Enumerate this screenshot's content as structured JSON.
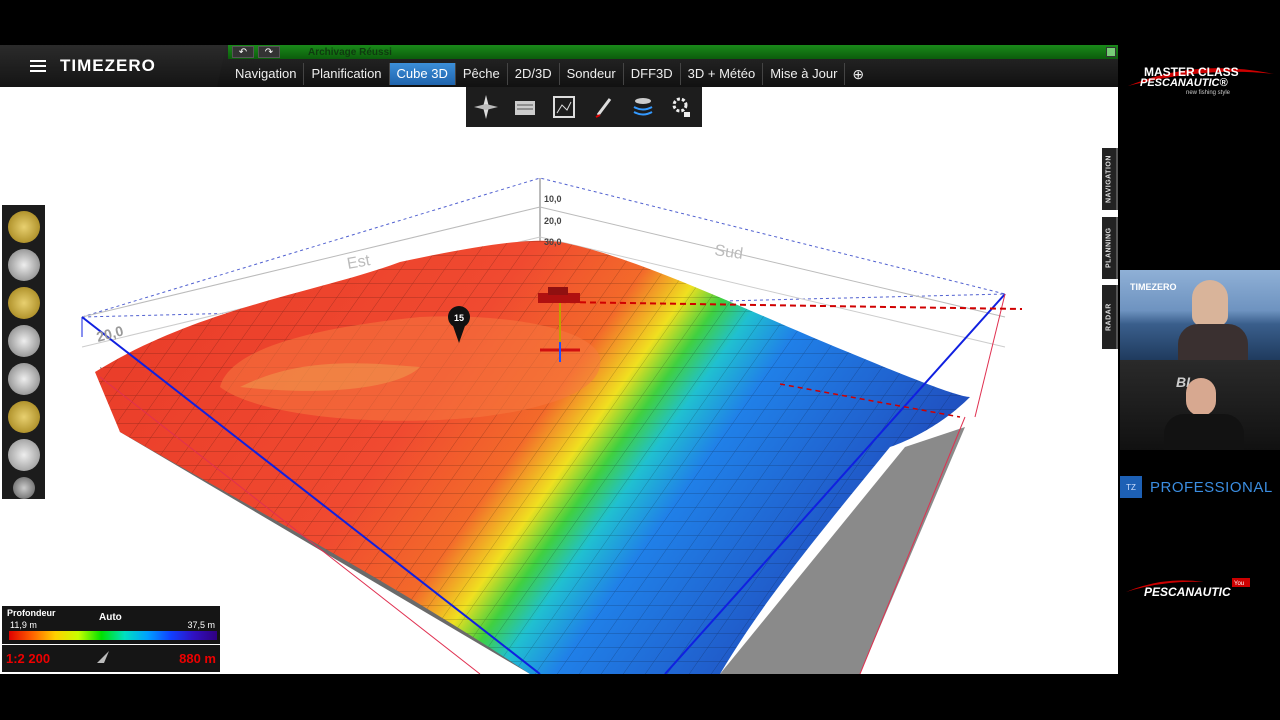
{
  "app": {
    "brand": "TIMEZERO",
    "status_message": "Archivage Réussi",
    "undo_symbol": "↶",
    "redo_symbol": "↷"
  },
  "tabs": [
    {
      "label": "Navigation",
      "active": false
    },
    {
      "label": "Planification",
      "active": false
    },
    {
      "label": "Cube 3D",
      "active": true
    },
    {
      "label": "Pêche",
      "active": false
    },
    {
      "label": "2D/3D",
      "active": false
    },
    {
      "label": "Sondeur",
      "active": false
    },
    {
      "label": "DFF3D",
      "active": false
    },
    {
      "label": "3D + Météo",
      "active": false
    },
    {
      "label": "Mise à Jour",
      "active": false
    },
    {
      "label": "⊕",
      "active": false
    }
  ],
  "tool_palette": [
    "compass-icon",
    "chart-tool-icon",
    "frame-icon",
    "pen-icon",
    "sonar-icon",
    "settings-lock-icon"
  ],
  "left_tools": [
    "ruler-icon",
    "route-icon",
    "mark-icon",
    "zoom-in-icon",
    "zoom-out-icon",
    "pan-icon",
    "hand-icon",
    "settings-icon"
  ],
  "scene": {
    "label_east": "Est",
    "label_south": "Sud",
    "label_depth_side": "20,0",
    "depth_ticks": [
      "10,0",
      "20,0",
      "30,0"
    ],
    "marker": "15"
  },
  "side_tabs": [
    "NAVIGATION",
    "PLANNING",
    "RADAR"
  ],
  "legend": {
    "title": "Profondeur",
    "mode": "Auto",
    "min": "11,9 m",
    "max": "37,5 m"
  },
  "scale": {
    "ratio": "1:2 200",
    "distance": "880 m"
  },
  "right_panel": {
    "brand_line1": "MASTER CLASS",
    "brand_line2": "PESCANAUTIC®",
    "brand_tagline": "new fishing style",
    "cam1_label": "TIMEZERO",
    "cam2_label": "BI",
    "pro_badge": "TZ",
    "pro_label": "PROFESSIONAL",
    "bottom_brand": "PESCANAUTIC",
    "bottom_small": "You"
  },
  "colors": {
    "active_tab": "#2f7fcf",
    "status_green": "#1a8a1a",
    "scale_red": "#e00000",
    "pro_blue": "#3b8de0"
  }
}
